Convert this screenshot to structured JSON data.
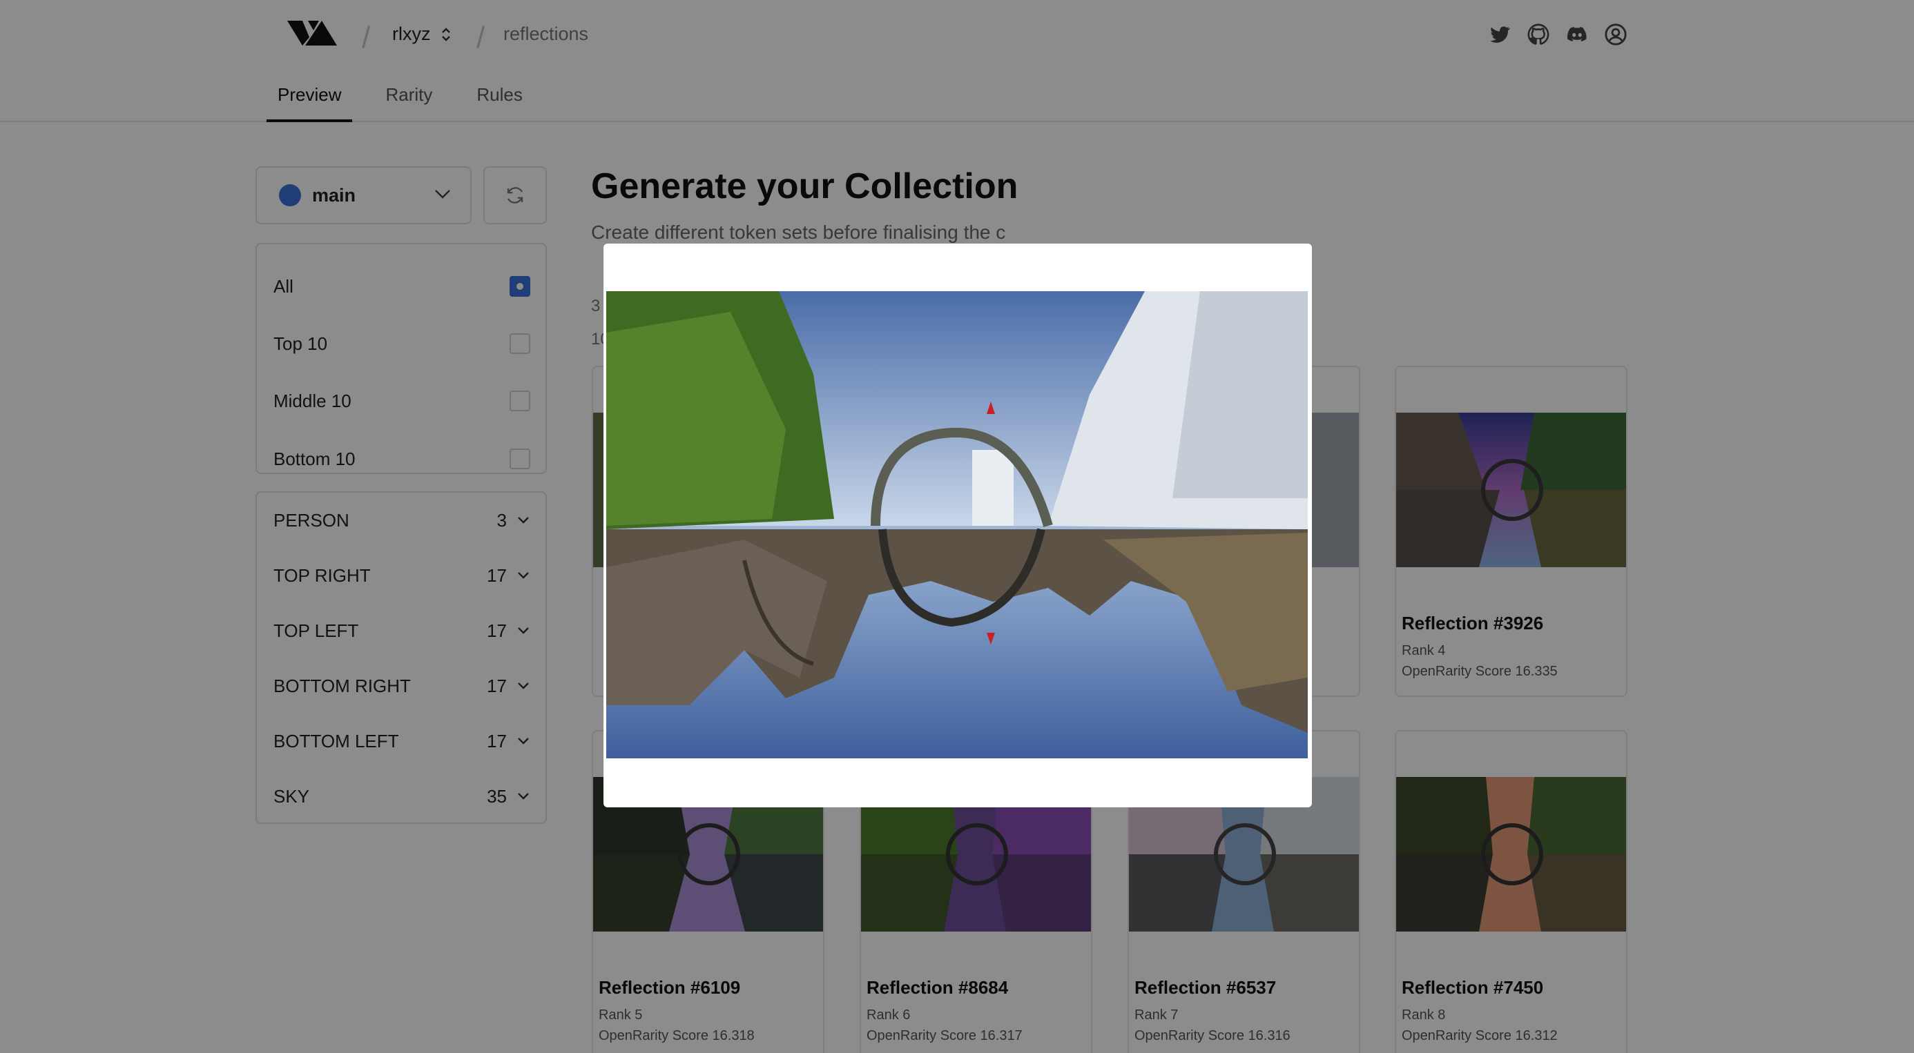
{
  "header": {
    "breadcrumb_user": "rlxyz",
    "breadcrumb_project": "reflections",
    "social_icons": [
      "twitter-icon",
      "github-icon",
      "discord-icon",
      "user-circle-icon"
    ],
    "tabs": [
      {
        "label": "Preview",
        "active": true
      },
      {
        "label": "Rarity",
        "active": false
      },
      {
        "label": "Rules",
        "active": false
      }
    ]
  },
  "sidebar": {
    "branch": {
      "label": "main",
      "color": "#3a6fd8"
    },
    "filters": [
      {
        "label": "All",
        "checked": true
      },
      {
        "label": "Top 10",
        "checked": false
      },
      {
        "label": "Middle 10",
        "checked": false
      },
      {
        "label": "Bottom 10",
        "checked": false
      }
    ],
    "traits": [
      {
        "name": "PERSON",
        "count": "3"
      },
      {
        "name": "TOP RIGHT",
        "count": "17"
      },
      {
        "name": "TOP LEFT",
        "count": "17"
      },
      {
        "name": "BOTTOM RIGHT",
        "count": "17"
      },
      {
        "name": "BOTTOM LEFT",
        "count": "17"
      },
      {
        "name": "SKY",
        "count": "35"
      }
    ]
  },
  "main": {
    "title": "Generate your Collection",
    "subtitle": "Create different token sets before finalising the c",
    "meta_1": "3",
    "meta_2": "10",
    "cards": [
      {
        "title": "Reflection #3926",
        "rank": "Rank 4",
        "score": "OpenRarity Score 16.335",
        "palette": "purple"
      },
      {
        "title": "Reflection #6109",
        "rank": "Rank 5",
        "score": "OpenRarity Score 16.318",
        "palette": "violet"
      },
      {
        "title": "Reflection #8684",
        "rank": "Rank 6",
        "score": "OpenRarity Score 16.317",
        "palette": "green-purple"
      },
      {
        "title": "Reflection #6537",
        "rank": "Rank 7",
        "score": "OpenRarity Score 16.316",
        "palette": "snow"
      },
      {
        "title": "Reflection #7450",
        "rank": "Rank 8",
        "score": "OpenRarity Score 16.312",
        "palette": "sunset"
      }
    ]
  },
  "modal": {
    "image_subject": "reflection-artwork"
  }
}
